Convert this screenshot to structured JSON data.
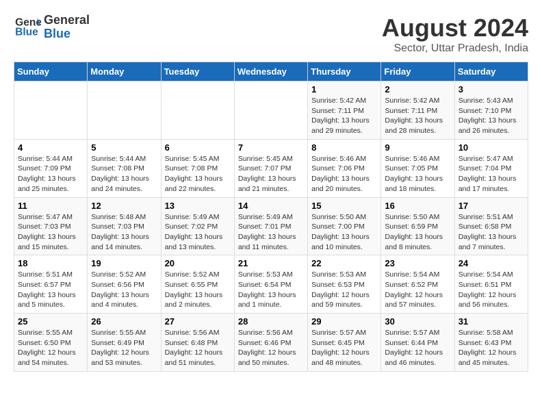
{
  "header": {
    "logo_line1": "General",
    "logo_line2": "Blue",
    "month_year": "August 2024",
    "location": "Sector, Uttar Pradesh, India"
  },
  "days_of_week": [
    "Sunday",
    "Monday",
    "Tuesday",
    "Wednesday",
    "Thursday",
    "Friday",
    "Saturday"
  ],
  "weeks": [
    [
      {
        "day": "",
        "info": ""
      },
      {
        "day": "",
        "info": ""
      },
      {
        "day": "",
        "info": ""
      },
      {
        "day": "",
        "info": ""
      },
      {
        "day": "1",
        "info": "Sunrise: 5:42 AM\nSunset: 7:11 PM\nDaylight: 13 hours\nand 29 minutes."
      },
      {
        "day": "2",
        "info": "Sunrise: 5:42 AM\nSunset: 7:11 PM\nDaylight: 13 hours\nand 28 minutes."
      },
      {
        "day": "3",
        "info": "Sunrise: 5:43 AM\nSunset: 7:10 PM\nDaylight: 13 hours\nand 26 minutes."
      }
    ],
    [
      {
        "day": "4",
        "info": "Sunrise: 5:44 AM\nSunset: 7:09 PM\nDaylight: 13 hours\nand 25 minutes."
      },
      {
        "day": "5",
        "info": "Sunrise: 5:44 AM\nSunset: 7:08 PM\nDaylight: 13 hours\nand 24 minutes."
      },
      {
        "day": "6",
        "info": "Sunrise: 5:45 AM\nSunset: 7:08 PM\nDaylight: 13 hours\nand 22 minutes."
      },
      {
        "day": "7",
        "info": "Sunrise: 5:45 AM\nSunset: 7:07 PM\nDaylight: 13 hours\nand 21 minutes."
      },
      {
        "day": "8",
        "info": "Sunrise: 5:46 AM\nSunset: 7:06 PM\nDaylight: 13 hours\nand 20 minutes."
      },
      {
        "day": "9",
        "info": "Sunrise: 5:46 AM\nSunset: 7:05 PM\nDaylight: 13 hours\nand 18 minutes."
      },
      {
        "day": "10",
        "info": "Sunrise: 5:47 AM\nSunset: 7:04 PM\nDaylight: 13 hours\nand 17 minutes."
      }
    ],
    [
      {
        "day": "11",
        "info": "Sunrise: 5:47 AM\nSunset: 7:03 PM\nDaylight: 13 hours\nand 15 minutes."
      },
      {
        "day": "12",
        "info": "Sunrise: 5:48 AM\nSunset: 7:03 PM\nDaylight: 13 hours\nand 14 minutes."
      },
      {
        "day": "13",
        "info": "Sunrise: 5:49 AM\nSunset: 7:02 PM\nDaylight: 13 hours\nand 13 minutes."
      },
      {
        "day": "14",
        "info": "Sunrise: 5:49 AM\nSunset: 7:01 PM\nDaylight: 13 hours\nand 11 minutes."
      },
      {
        "day": "15",
        "info": "Sunrise: 5:50 AM\nSunset: 7:00 PM\nDaylight: 13 hours\nand 10 minutes."
      },
      {
        "day": "16",
        "info": "Sunrise: 5:50 AM\nSunset: 6:59 PM\nDaylight: 13 hours\nand 8 minutes."
      },
      {
        "day": "17",
        "info": "Sunrise: 5:51 AM\nSunset: 6:58 PM\nDaylight: 13 hours\nand 7 minutes."
      }
    ],
    [
      {
        "day": "18",
        "info": "Sunrise: 5:51 AM\nSunset: 6:57 PM\nDaylight: 13 hours\nand 5 minutes."
      },
      {
        "day": "19",
        "info": "Sunrise: 5:52 AM\nSunset: 6:56 PM\nDaylight: 13 hours\nand 4 minutes."
      },
      {
        "day": "20",
        "info": "Sunrise: 5:52 AM\nSunset: 6:55 PM\nDaylight: 13 hours\nand 2 minutes."
      },
      {
        "day": "21",
        "info": "Sunrise: 5:53 AM\nSunset: 6:54 PM\nDaylight: 13 hours\nand 1 minute."
      },
      {
        "day": "22",
        "info": "Sunrise: 5:53 AM\nSunset: 6:53 PM\nDaylight: 12 hours\nand 59 minutes."
      },
      {
        "day": "23",
        "info": "Sunrise: 5:54 AM\nSunset: 6:52 PM\nDaylight: 12 hours\nand 57 minutes."
      },
      {
        "day": "24",
        "info": "Sunrise: 5:54 AM\nSunset: 6:51 PM\nDaylight: 12 hours\nand 56 minutes."
      }
    ],
    [
      {
        "day": "25",
        "info": "Sunrise: 5:55 AM\nSunset: 6:50 PM\nDaylight: 12 hours\nand 54 minutes."
      },
      {
        "day": "26",
        "info": "Sunrise: 5:55 AM\nSunset: 6:49 PM\nDaylight: 12 hours\nand 53 minutes."
      },
      {
        "day": "27",
        "info": "Sunrise: 5:56 AM\nSunset: 6:48 PM\nDaylight: 12 hours\nand 51 minutes."
      },
      {
        "day": "28",
        "info": "Sunrise: 5:56 AM\nSunset: 6:46 PM\nDaylight: 12 hours\nand 50 minutes."
      },
      {
        "day": "29",
        "info": "Sunrise: 5:57 AM\nSunset: 6:45 PM\nDaylight: 12 hours\nand 48 minutes."
      },
      {
        "day": "30",
        "info": "Sunrise: 5:57 AM\nSunset: 6:44 PM\nDaylight: 12 hours\nand 46 minutes."
      },
      {
        "day": "31",
        "info": "Sunrise: 5:58 AM\nSunset: 6:43 PM\nDaylight: 12 hours\nand 45 minutes."
      }
    ]
  ]
}
